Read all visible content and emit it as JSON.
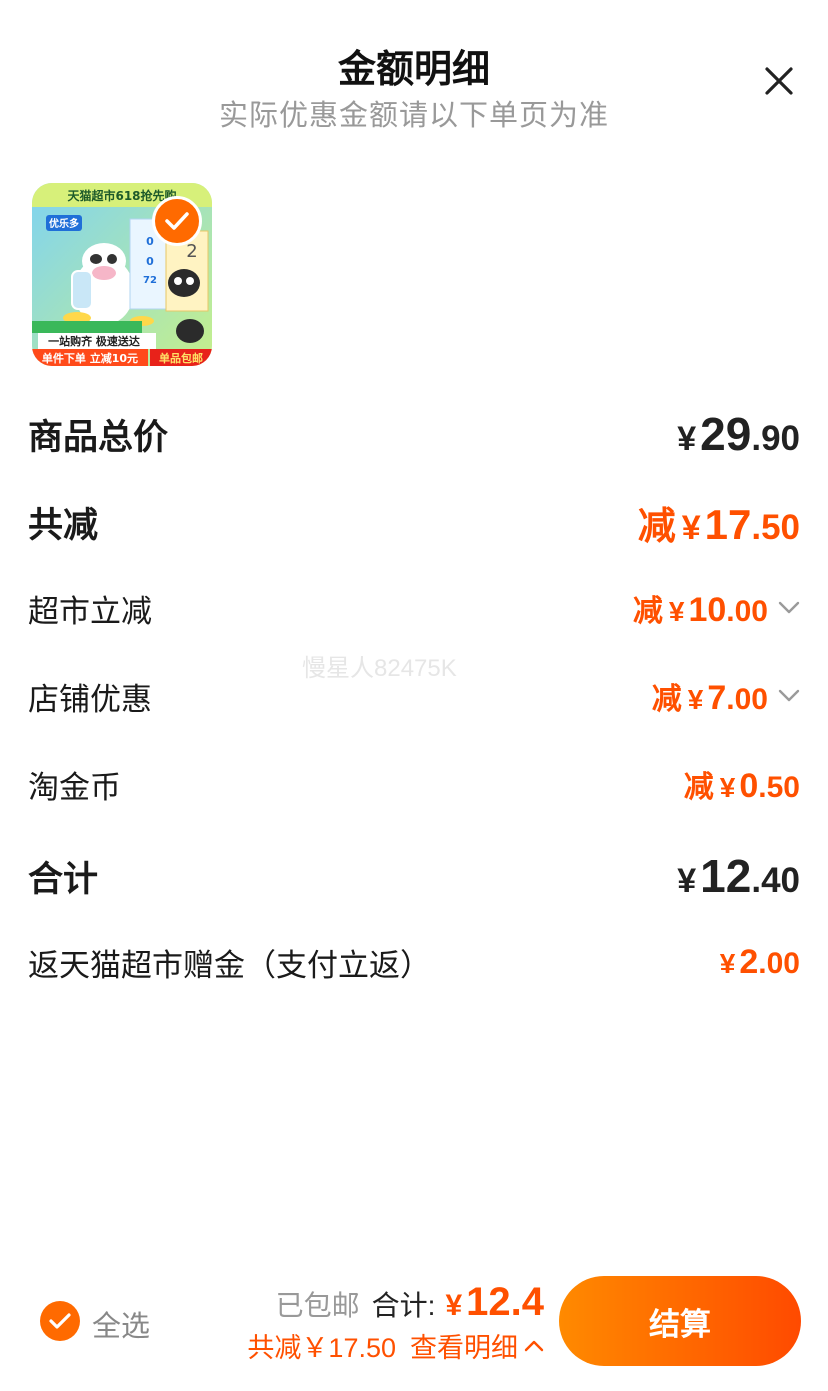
{
  "header": {
    "title": "金额明细",
    "subtitle": "实际优惠金额请以下单页为准"
  },
  "product": {
    "banner_top": "天猫超市618抢先购",
    "brand": "优乐多",
    "banner_mid": "一站购齐 极速送达",
    "banner_left": "单件下单 立减10元",
    "banner_right": "单品包邮",
    "box_number": "2"
  },
  "rows": {
    "total_price": {
      "label": "商品总价",
      "yen": "¥",
      "int": "29",
      "dec": ".90"
    },
    "total_discount": {
      "label": "共减",
      "prefix": "减",
      "yen": "¥",
      "int": "17",
      "dec": ".50"
    },
    "supermarket_discount": {
      "label": "超市立减",
      "prefix": "减",
      "yen": "¥",
      "int": "10",
      "dec": ".00"
    },
    "store_discount": {
      "label": "店铺优惠",
      "prefix": "减",
      "yen": "¥",
      "int": "7",
      "dec": ".00"
    },
    "taojin_coin": {
      "label": "淘金币",
      "prefix": "减",
      "yen": "¥",
      "int": "0",
      "dec": ".50"
    },
    "subtotal": {
      "label": "合计",
      "yen": "¥",
      "int": "12",
      "dec": ".40"
    },
    "cashback": {
      "label": "返天猫超市赠金（支付立返）",
      "yen": "¥",
      "int": "2",
      "dec": ".00"
    }
  },
  "watermark": "慢星人82475K",
  "footer": {
    "select_all": "全选",
    "shipping": "已包邮",
    "total_label": "合计:",
    "total_yen": "¥",
    "total_value": "12.4",
    "discount_text": "共减￥17.50",
    "details_link": "查看明细",
    "checkout": "结算"
  },
  "colors": {
    "accent": "#ff5000",
    "accent_light": "#ff8a00",
    "text": "#1a1a1a",
    "muted": "#999999"
  },
  "icons": [
    "close-icon",
    "check-icon",
    "chevron-down-icon",
    "chevron-up-icon"
  ]
}
